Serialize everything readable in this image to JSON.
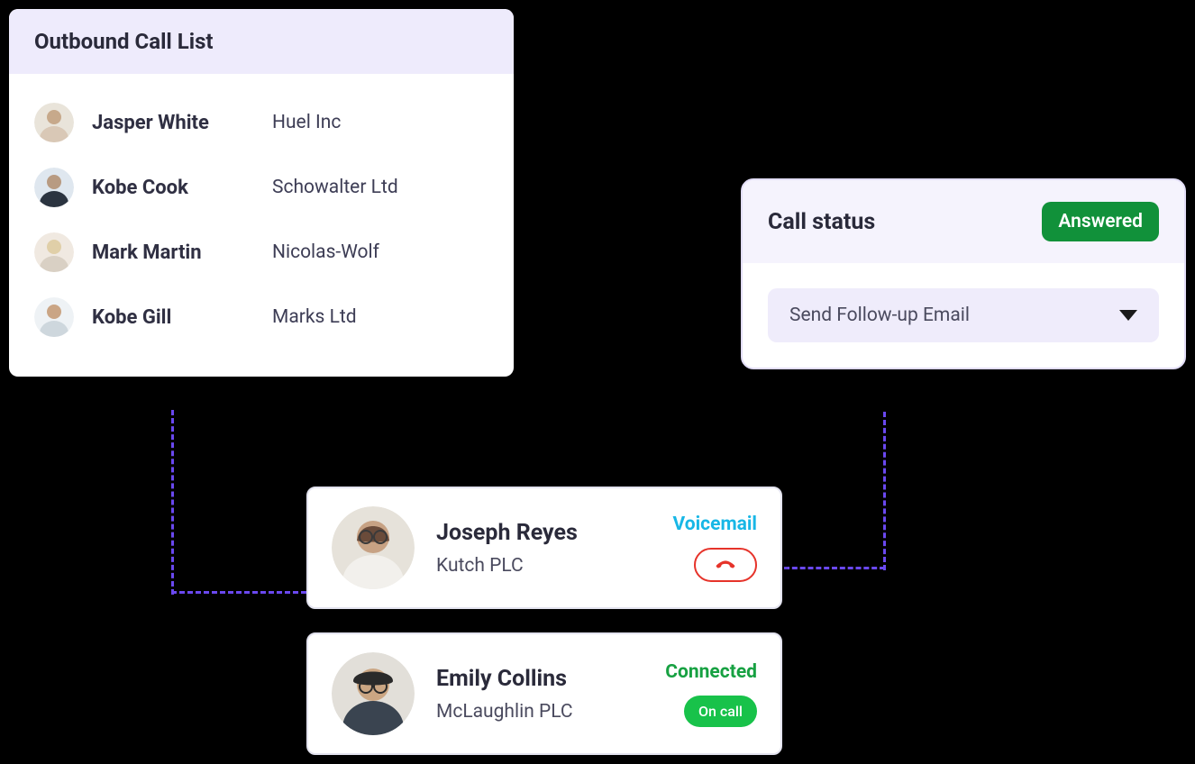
{
  "outbound": {
    "title": "Outbound Call List",
    "rows": [
      {
        "name": "Jasper White",
        "company": "Huel Inc"
      },
      {
        "name": "Kobe Cook",
        "company": "Schowalter Ltd"
      },
      {
        "name": "Mark Martin",
        "company": "Nicolas-Wolf"
      },
      {
        "name": "Kobe Gill",
        "company": "Marks Ltd"
      }
    ]
  },
  "status_panel": {
    "title": "Call status",
    "badge": "Answered",
    "followup_label": "Send Follow-up Email"
  },
  "call_cards": [
    {
      "name": "Joseph Reyes",
      "company": "Kutch PLC",
      "status": "Voicemail",
      "action": "hangup"
    },
    {
      "name": "Emily Collins",
      "company": "McLaughlin PLC",
      "status": "Connected",
      "action_label": "On call"
    }
  ]
}
